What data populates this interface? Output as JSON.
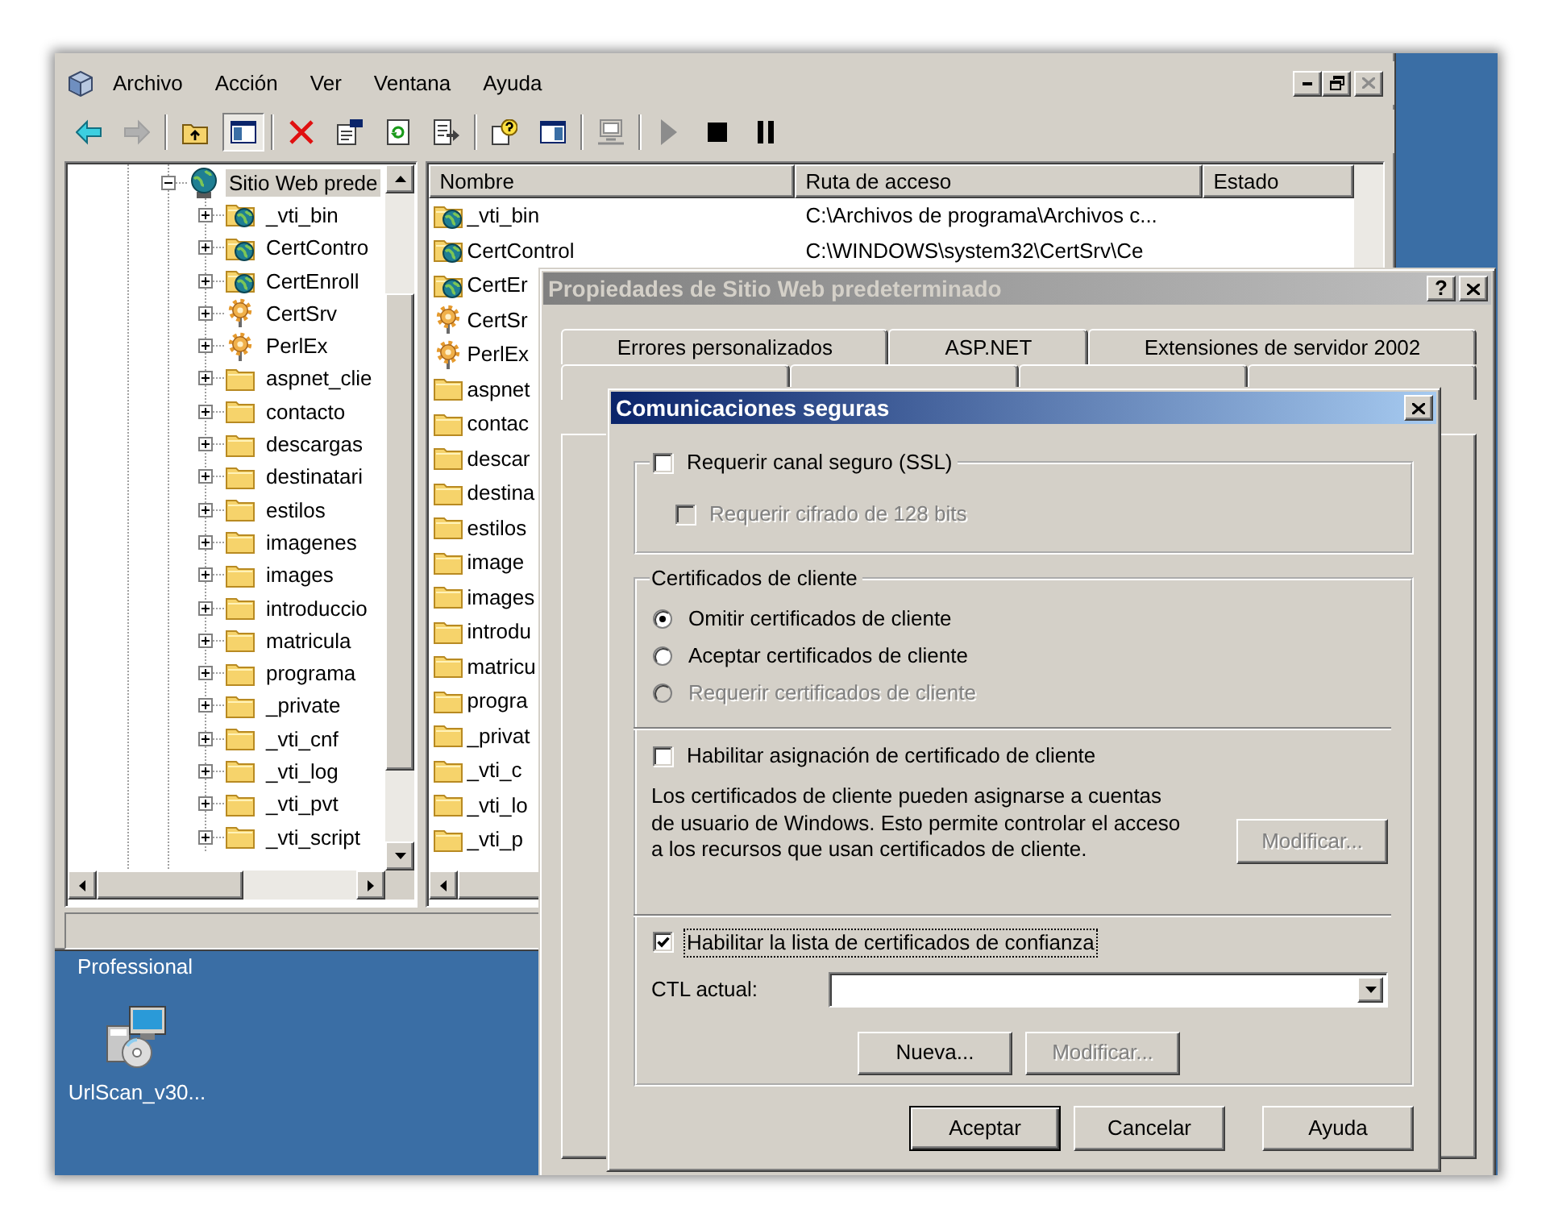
{
  "console": {
    "menus": [
      "Archivo",
      "Acción",
      "Ver",
      "Ventana",
      "Ayuda"
    ],
    "window_controls": [
      {
        "kind": "minimize",
        "disabled": false
      },
      {
        "kind": "restore",
        "disabled": false
      },
      {
        "kind": "close",
        "disabled": true
      }
    ],
    "toolbar": [
      [
        {
          "kind": "back",
          "disabled": false,
          "pressed": false
        },
        {
          "kind": "forward",
          "disabled": true,
          "pressed": false
        }
      ],
      [
        {
          "kind": "up",
          "disabled": false,
          "pressed": false
        },
        {
          "kind": "tree",
          "disabled": false,
          "pressed": true
        }
      ],
      [
        {
          "kind": "delete",
          "disabled": false,
          "pressed": false
        },
        {
          "kind": "properties",
          "disabled": false,
          "pressed": false
        },
        {
          "kind": "refresh",
          "disabled": false,
          "pressed": false
        },
        {
          "kind": "export",
          "disabled": false,
          "pressed": false
        }
      ],
      [
        {
          "kind": "help",
          "disabled": false,
          "pressed": false
        },
        {
          "kind": "pane",
          "disabled": false,
          "pressed": false
        }
      ],
      [
        {
          "kind": "computer",
          "disabled": true,
          "pressed": false
        }
      ],
      [
        {
          "kind": "play",
          "disabled": true,
          "pressed": false
        },
        {
          "kind": "stop",
          "disabled": false,
          "pressed": false
        },
        {
          "kind": "pause",
          "disabled": false,
          "pressed": false
        }
      ]
    ],
    "tree": {
      "label": "Sitio Web prede",
      "kind": "site",
      "selected": true,
      "expanded": true,
      "children": [
        {
          "label": "_vti_bin",
          "kind": "web",
          "selected": false,
          "expanded": false
        },
        {
          "label": "CertContro",
          "kind": "web",
          "selected": false,
          "expanded": false
        },
        {
          "label": "CertEnroll",
          "kind": "web",
          "selected": false,
          "expanded": false
        },
        {
          "label": "CertSrv",
          "kind": "app",
          "selected": false,
          "expanded": false
        },
        {
          "label": "PerlEx",
          "kind": "app",
          "selected": false,
          "expanded": false
        },
        {
          "label": "aspnet_clie",
          "kind": "folder",
          "selected": false,
          "expanded": false
        },
        {
          "label": "contacto",
          "kind": "folder",
          "selected": false,
          "expanded": false
        },
        {
          "label": "descargas",
          "kind": "folder",
          "selected": false,
          "expanded": false
        },
        {
          "label": "destinatari",
          "kind": "folder",
          "selected": false,
          "expanded": false
        },
        {
          "label": "estilos",
          "kind": "folder",
          "selected": false,
          "expanded": false
        },
        {
          "label": "imagenes",
          "kind": "folder",
          "selected": false,
          "expanded": false
        },
        {
          "label": "images",
          "kind": "folder",
          "selected": false,
          "expanded": false
        },
        {
          "label": "introduccio",
          "kind": "folder",
          "selected": false,
          "expanded": false
        },
        {
          "label": "matricula",
          "kind": "folder",
          "selected": false,
          "expanded": false
        },
        {
          "label": "programa",
          "kind": "folder",
          "selected": false,
          "expanded": false
        },
        {
          "label": "_private",
          "kind": "folder",
          "selected": false,
          "expanded": false
        },
        {
          "label": "_vti_cnf",
          "kind": "folder",
          "selected": false,
          "expanded": false
        },
        {
          "label": "_vti_log",
          "kind": "folder",
          "selected": false,
          "expanded": false
        },
        {
          "label": "_vti_pvt",
          "kind": "folder",
          "selected": false,
          "expanded": false
        },
        {
          "label": "_vti_script",
          "kind": "folder",
          "selected": false,
          "expanded": false
        }
      ]
    },
    "list": {
      "columns": [
        "Nombre",
        "Ruta de acceso",
        "Estado"
      ],
      "rows": [
        {
          "kind": "web",
          "name": "_vti_bin",
          "path": "C:\\Archivos de programa\\Archivos c..."
        },
        {
          "kind": "web",
          "name": "CertControl",
          "path": "C:\\WINDOWS\\system32\\CertSrv\\Ce"
        },
        {
          "kind": "web",
          "name": "CertEr"
        },
        {
          "kind": "app",
          "name": "CertSr"
        },
        {
          "kind": "app",
          "name": "PerlEx"
        },
        {
          "kind": "folder",
          "name": "aspnet"
        },
        {
          "kind": "folder",
          "name": "contac"
        },
        {
          "kind": "folder",
          "name": "descar"
        },
        {
          "kind": "folder",
          "name": "destina"
        },
        {
          "kind": "folder",
          "name": "estilos"
        },
        {
          "kind": "folder",
          "name": "image"
        },
        {
          "kind": "folder",
          "name": "images"
        },
        {
          "kind": "folder",
          "name": "introdu"
        },
        {
          "kind": "folder",
          "name": "matricu"
        },
        {
          "kind": "folder",
          "name": "progra"
        },
        {
          "kind": "folder",
          "name": "_privat"
        },
        {
          "kind": "folder",
          "name": "_vti_c"
        },
        {
          "kind": "folder",
          "name": "_vti_lo"
        },
        {
          "kind": "folder",
          "name": "_vti_p"
        }
      ]
    }
  },
  "desktop": {
    "caption": "Professional",
    "icons": [
      {
        "label": "UrlScan_v30..."
      }
    ]
  },
  "properties_dialog": {
    "title": "Propiedades de Sitio Web predeterminado",
    "active": false,
    "help_button": "?",
    "tab_rows": [
      [
        {
          "label": "Errores personalizados",
          "selected": false
        },
        {
          "label": "ASP.NET",
          "selected": false
        },
        {
          "label": "Extensiones de servidor 2002",
          "selected": false
        }
      ],
      [
        {
          "selected": false
        },
        {
          "selected": false
        },
        {
          "selected": false
        },
        {
          "selected": false
        }
      ]
    ]
  },
  "secure_dialog": {
    "title": "Comunicaciones seguras",
    "active": true,
    "ssl": {
      "label": "Requerir canal seguro (SSL)",
      "checked": false,
      "disabled": false
    },
    "cipher": {
      "label": "Requerir cifrado de 128 bits",
      "checked": false,
      "disabled": true
    },
    "client_certificates": {
      "title": "Certificados de cliente",
      "options": [
        {
          "label": "Omitir certificados de cliente",
          "selected": true,
          "disabled": false
        },
        {
          "label": "Aceptar certificados de cliente",
          "selected": false,
          "disabled": false
        },
        {
          "label": "Requerir certificados de cliente",
          "selected": false,
          "disabled": true
        }
      ]
    },
    "mapping": {
      "label": "Habilitar asignación de certificado de cliente",
      "checked": false,
      "disabled": false
    },
    "mapping_text": "Los certificados de cliente pueden asignarse a cuentas\nde usuario de Windows. Esto permite controlar el acceso\na los recursos que usan certificados de cliente.",
    "mapping_button": {
      "label": "Modificar...",
      "disabled": true
    },
    "ctl": {
      "label": "Habilitar la lista de certificados de confianza",
      "checked": true,
      "disabled": false,
      "focused": true
    },
    "ctl_field": {
      "label": "CTL actual:"
    },
    "ctl_buttons": [
      {
        "label": "Nueva...",
        "disabled": false
      },
      {
        "label": "Modificar...",
        "disabled": true
      }
    ],
    "buttons": [
      {
        "label": "Aceptar",
        "default": true
      },
      {
        "label": "Cancelar",
        "default": false
      },
      {
        "label": "Ayuda",
        "default": false
      }
    ]
  }
}
